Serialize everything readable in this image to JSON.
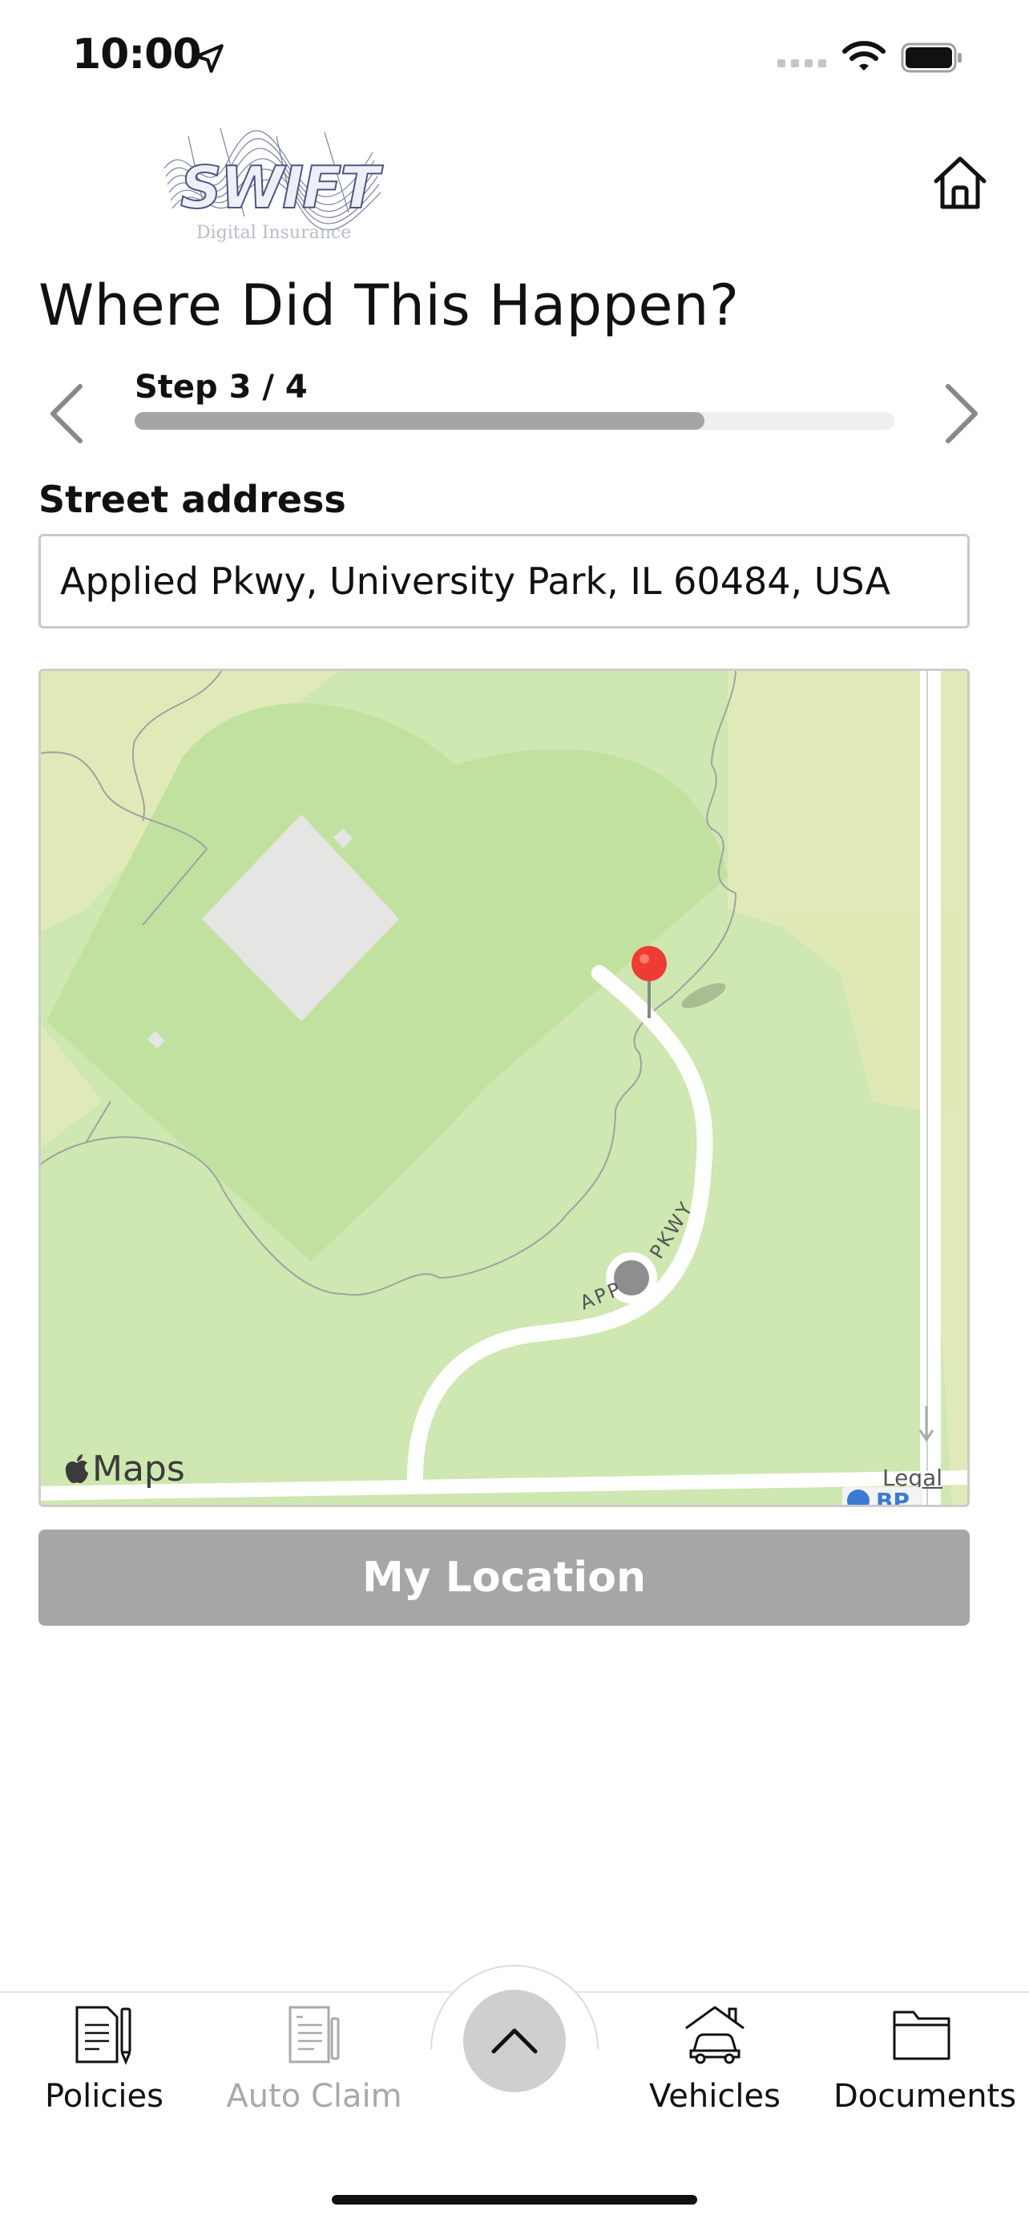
{
  "status_bar": {
    "time": "10:00"
  },
  "header": {
    "logo_text": "SWIFT",
    "logo_subtitle": "Digital Insurance",
    "page_title": "Where Did This Happen?"
  },
  "stepper": {
    "label": "Step 3 / 4",
    "current": 3,
    "total": 4,
    "progress_fraction": 0.75
  },
  "address": {
    "label": "Street address",
    "value": "Applied Pkwy, University Park, IL 60484, USA"
  },
  "map": {
    "brand": "Maps",
    "legal": "Legal",
    "road_label_left": "APP",
    "road_label_right": "PKWY",
    "poi_label": "BP"
  },
  "actions": {
    "my_location": "My Location"
  },
  "tab_bar": {
    "tabs": [
      {
        "label": "Policies",
        "active": true
      },
      {
        "label": "Auto Claim",
        "active": false
      },
      {
        "label": "Vehicles",
        "active": true
      },
      {
        "label": "Documents",
        "active": true
      }
    ]
  },
  "colors": {
    "progress_fill": "#a5a5a7",
    "button_disabled": "#a6a6a6",
    "map_park": "#cfe7b0",
    "map_pin": "#ee3b33"
  }
}
